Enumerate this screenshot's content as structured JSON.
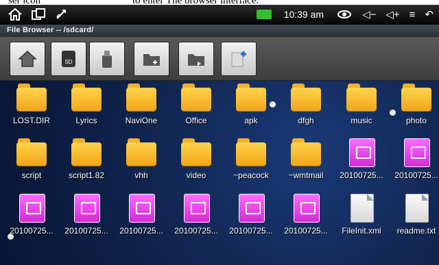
{
  "doc_caption": {
    "part1": "ser icon",
    "part2": "to enter The browser interface."
  },
  "statusbar": {
    "time": "10:39 am",
    "icons": [
      "home-icon",
      "multitask-icon",
      "usb-debug-icon",
      "battery-icon",
      "eye-icon",
      "volume-down-icon",
      "volume-up-icon",
      "menu-icon",
      "back-icon"
    ],
    "volume_down_label": "◁−",
    "volume_up_label": "◁+",
    "menu_label": "≡",
    "back_label": "↶"
  },
  "title": "File Browser -- /sdcard/",
  "toolbar": {
    "buttons": [
      "home-button",
      "sd-card-button",
      "usb-button",
      "new-folder-button",
      "open-folder-button",
      "new-file-button"
    ],
    "sd_label": "SD"
  },
  "files": [
    {
      "name": "LOST.DIR",
      "type": "folder"
    },
    {
      "name": "Lyrics",
      "type": "folder"
    },
    {
      "name": "NaviOne",
      "type": "folder"
    },
    {
      "name": "Office",
      "type": "folder"
    },
    {
      "name": "apk",
      "type": "folder"
    },
    {
      "name": "dfgh",
      "type": "folder"
    },
    {
      "name": "music",
      "type": "folder"
    },
    {
      "name": "photo",
      "type": "folder"
    },
    {
      "name": "script",
      "type": "folder"
    },
    {
      "name": "script1.82",
      "type": "folder"
    },
    {
      "name": "vhh",
      "type": "folder"
    },
    {
      "name": "video",
      "type": "folder"
    },
    {
      "name": "~peacock",
      "type": "folder"
    },
    {
      "name": "~wmtmail",
      "type": "folder"
    },
    {
      "name": "20100725...",
      "type": "image"
    },
    {
      "name": "20100725...",
      "type": "image"
    },
    {
      "name": "20100725...",
      "type": "image"
    },
    {
      "name": "20100725...",
      "type": "image"
    },
    {
      "name": "20100725...",
      "type": "image"
    },
    {
      "name": "20100725...",
      "type": "image"
    },
    {
      "name": "20100725...",
      "type": "image"
    },
    {
      "name": "20100725...",
      "type": "image"
    },
    {
      "name": "FileInit.xml",
      "type": "document"
    },
    {
      "name": "readme.txt",
      "type": "document"
    }
  ]
}
